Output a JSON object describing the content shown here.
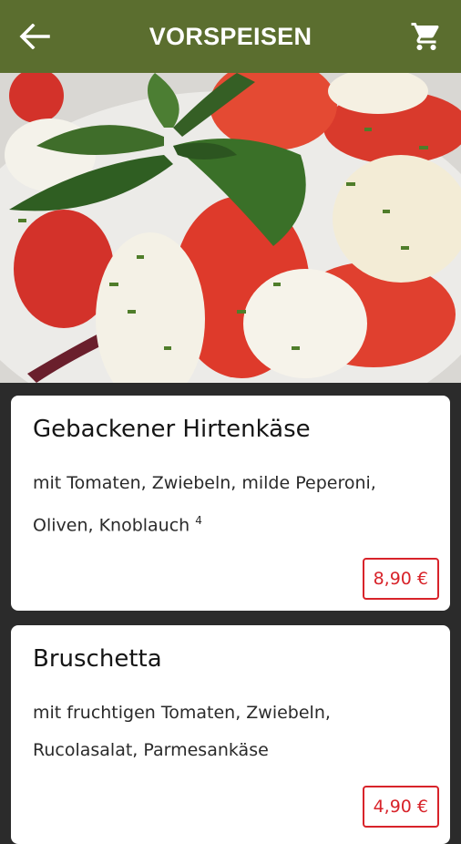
{
  "header": {
    "title": "VORSPEISEN",
    "back_icon": "arrow-left-icon",
    "cart_icon": "shopping-cart-icon",
    "bar_color": "#5b6e2f"
  },
  "hero": {
    "image": "caprese-salad-photo"
  },
  "items": [
    {
      "name": "Gebackener Hirtenkäse",
      "description": "mit Tomaten, Zwiebeln, milde Peperoni, Oliven, Knoblauch",
      "footnote": "4",
      "price": "8,90 €"
    },
    {
      "name": "Bruschetta",
      "description": "mit fruchtigen Tomaten, Zwiebeln, Rucolasalat, Parmesankäse",
      "footnote": "",
      "price": "4,90 €"
    }
  ],
  "colors": {
    "price_accent": "#d8232a",
    "background": "#2b2b2b"
  }
}
